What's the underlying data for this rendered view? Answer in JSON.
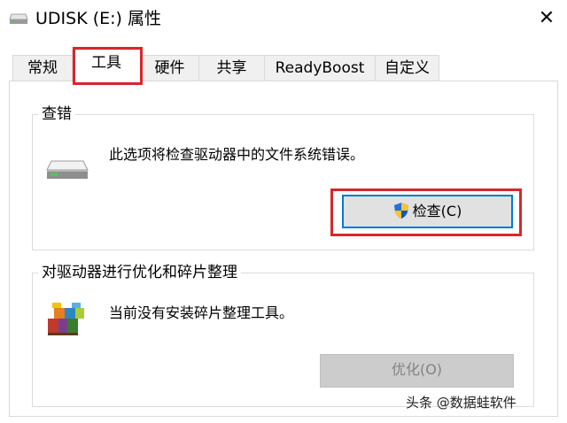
{
  "window": {
    "title": "UDISK (E:) 属性",
    "close_label": "✕"
  },
  "tabs": [
    {
      "label": "常规"
    },
    {
      "label": "工具",
      "active": true
    },
    {
      "label": "硬件"
    },
    {
      "label": "共享"
    },
    {
      "label": "ReadyBoost"
    },
    {
      "label": "自定义"
    }
  ],
  "error_check": {
    "title": "查错",
    "description": "此选项将检查驱动器中的文件系统错误。",
    "button_label": "检查(C)"
  },
  "optimize": {
    "title": "对驱动器进行优化和碎片整理",
    "description": "当前没有安装碎片整理工具。",
    "button_label": "优化(O)",
    "button_enabled": false
  },
  "watermark": "头条 @数据蛙软件",
  "colors": {
    "highlight": "#d9262a",
    "focus_border": "#0078d7",
    "tab_bg": "#f0f0f0",
    "disabled_button": "#cccccc"
  }
}
